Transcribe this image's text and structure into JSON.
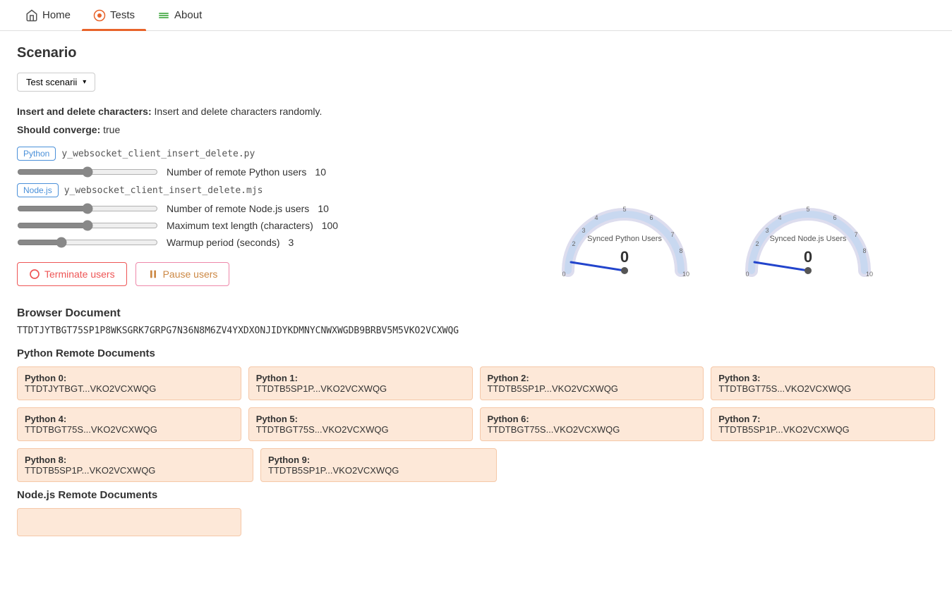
{
  "nav": {
    "home_label": "Home",
    "tests_label": "Tests",
    "about_label": "About"
  },
  "page": {
    "scenario_title": "Scenario",
    "dropdown_label": "Test scenarii",
    "description_label": "Insert and delete characters:",
    "description_text": " Insert and delete characters randomly.",
    "converge_label": "Should converge:",
    "converge_value": "true",
    "python_file": "y_websocket_client_insert_delete.py",
    "nodejs_file": "y_websocket_client_insert_delete.mjs",
    "python_badge": "Python",
    "nodejs_badge": "Node.js",
    "slider1_label": "Number of remote Python users",
    "slider1_value": "10",
    "slider2_label": "Number of remote Node.js users",
    "slider2_value": "10",
    "slider3_label": "Maximum text length (characters)",
    "slider3_value": "100",
    "slider4_label": "Warmup period (seconds)",
    "slider4_value": "3",
    "terminate_label": "Terminate users",
    "pause_label": "Pause users",
    "gauge1_label": "Synced Python Users",
    "gauge1_value": "0",
    "gauge2_label": "Synced Node.js Users",
    "gauge2_value": "0",
    "browser_doc_title": "Browser Document",
    "browser_doc_string": "TTDTJYTBGT75SP1P8WKSGRK7GRPG7N36N8M6ZV4YXDXONJIDYKDMNYCNWXWGDB9BRBV5M5VKO2VCXWQG",
    "python_docs_title": "Python Remote Documents",
    "nodejs_docs_title": "Node.js Remote Documents",
    "python_docs": [
      {
        "label": "Python 0:",
        "value": "TTDTJYTBGT...VKO2VCXWQG"
      },
      {
        "label": "Python 1:",
        "value": "TTDTB5SP1P...VKO2VCXWQG"
      },
      {
        "label": "Python 2:",
        "value": "TTDTB5SP1P...VKO2VCXWQG"
      },
      {
        "label": "Python 3:",
        "value": "TTDTBGT75S...VKO2VCXWQG"
      },
      {
        "label": "Python 4:",
        "value": "TTDTBGT75S...VKO2VCXWQG"
      },
      {
        "label": "Python 5:",
        "value": "TTDTBGT75S...VKO2VCXWQG"
      },
      {
        "label": "Python 6:",
        "value": "TTDTBGT75S...VKO2VCXWQG"
      },
      {
        "label": "Python 7:",
        "value": "TTDTB5SP1P...VKO2VCXWQG"
      },
      {
        "label": "Python 8:",
        "value": "TTDTB5SP1P...VKO2VCXWQG"
      },
      {
        "label": "Python 9:",
        "value": "TTDTB5SP1P...VKO2VCXWQG"
      }
    ]
  }
}
